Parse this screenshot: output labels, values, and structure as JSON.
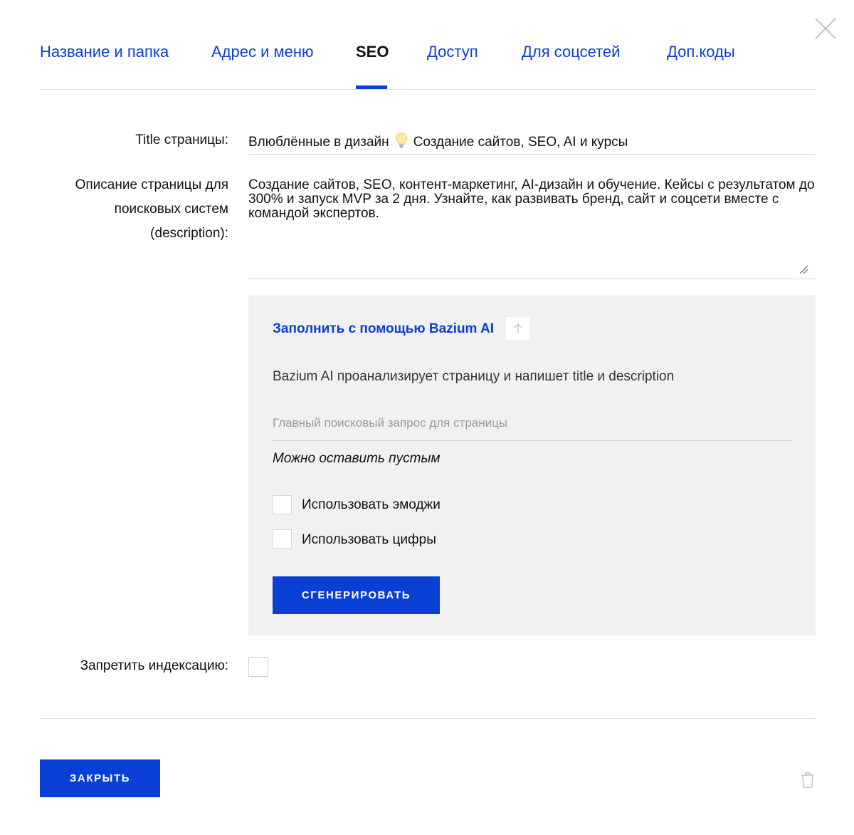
{
  "tabs": [
    {
      "label": "Название и папка"
    },
    {
      "label": "Адрес и меню"
    },
    {
      "label": "SEO",
      "active": true
    },
    {
      "label": "Доступ"
    },
    {
      "label": "Для соцсетей"
    },
    {
      "label": "Доп.коды"
    }
  ],
  "icons": {
    "close": "close-icon",
    "bulb": "lightbulb-icon",
    "upload": "arrow-up-icon",
    "resize": "resize-handle-icon",
    "delete": "trash-icon"
  },
  "colors": {
    "accent": "#0a3fd6",
    "panel_bg": "#f1f1f1",
    "divider": "#dedede"
  },
  "form": {
    "title_label": "Title страницы:",
    "title_value_part1": "Влюблённые в дизайн",
    "title_value_part2": "Создание сайтов, SEO, AI и курсы",
    "desc_label_line1": "Описание страницы для",
    "desc_label_line2": "поисковых систем",
    "desc_label_line3": "(description):",
    "desc_value": "Создание сайтов, SEO, контент-маркетинг, AI-дизайн и обучение. Кейсы с результатом до 300% и запуск MVP за 2 дня. Узнайте, как развивать бренд, сайт и соцсети вместе с командой экспертов.",
    "noindex_label": "Запретить индексацию:",
    "noindex_checked": false
  },
  "ai": {
    "title": "Заполнить с помощью Bazium AI",
    "description": "Bazium AI проанализирует страницу и напишет title и description",
    "query_placeholder": "Главный поисковый запрос для страницы",
    "query_value": "",
    "hint": "Можно оставить пустым",
    "checkbox_emoji_label": "Использовать эмоджи",
    "checkbox_emoji_checked": false,
    "checkbox_digits_label": "Использовать цифры",
    "checkbox_digits_checked": false,
    "generate_label": "СГЕНЕРИРОВАТЬ"
  },
  "footer": {
    "close_label": "ЗАКРЫТЬ"
  }
}
